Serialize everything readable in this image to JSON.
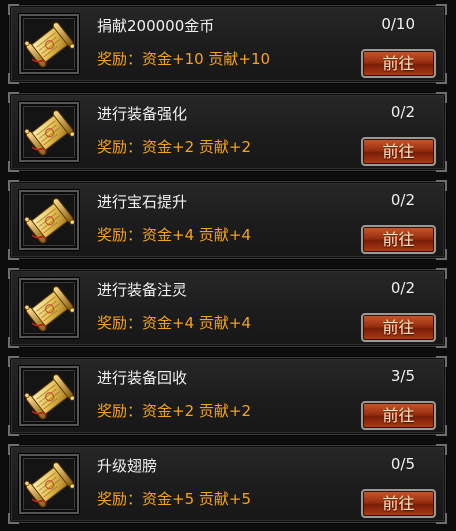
{
  "tasks": [
    {
      "title": "捐献200000金币",
      "progress": "0/10",
      "reward": "奖励：资金+10   贡献+10",
      "button": "前往"
    },
    {
      "title": "进行装备强化",
      "progress": "0/2",
      "reward": "奖励：资金+2   贡献+2",
      "button": "前往"
    },
    {
      "title": "进行宝石提升",
      "progress": "0/2",
      "reward": "奖励：资金+4   贡献+4",
      "button": "前往"
    },
    {
      "title": "进行装备注灵",
      "progress": "0/2",
      "reward": "奖励：资金+4   贡献+4",
      "button": "前往"
    },
    {
      "title": "进行装备回收",
      "progress": "3/5",
      "reward": "奖励：资金+2   贡献+2",
      "button": "前往"
    },
    {
      "title": "升级翅膀",
      "progress": "0/5",
      "reward": "奖励：资金+5   贡献+5",
      "button": "前往"
    }
  ],
  "icons": {
    "task_icon": "scroll-icon"
  },
  "colors": {
    "title_text": "#f0f0f0",
    "reward_text": "#f7a21b",
    "button_top": "#c95a2b",
    "button_bottom": "#7a1d06",
    "panel_bg": "#1c1c1c"
  }
}
